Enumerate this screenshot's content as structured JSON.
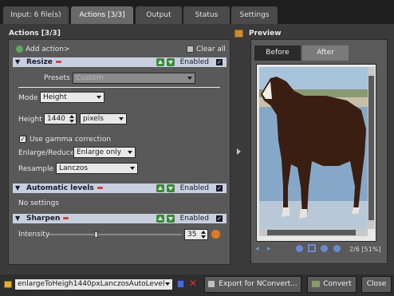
{
  "tabs": [
    {
      "label": "Input: 6 file(s)",
      "active": false
    },
    {
      "label": "Actions [3/3]",
      "active": true
    },
    {
      "label": "Output",
      "active": false
    },
    {
      "label": "Status",
      "active": false
    },
    {
      "label": "Settings",
      "active": false
    }
  ],
  "actions_title": "Actions [3/3]",
  "preview_title": "Preview",
  "toolbar": {
    "add_action": "Add action>",
    "clear_all": "Clear all"
  },
  "resize": {
    "name": "Resize",
    "enabled_label": "Enabled",
    "presets_label": "Presets",
    "presets_value": "Custom",
    "mode_label": "Mode",
    "mode_value": "Height",
    "height_label": "Height",
    "height_value": "1440",
    "unit_value": "pixels",
    "gamma_label": "Use gamma correction",
    "enlarge_label": "Enlarge/Reduce",
    "enlarge_value": "Enlarge only",
    "resample_label": "Resample",
    "resample_value": "Lanczos"
  },
  "auto_levels": {
    "name": "Automatic levels",
    "enabled_label": "Enabled",
    "no_settings": "No settings"
  },
  "sharpen": {
    "name": "Sharpen",
    "enabled_label": "Enabled",
    "intensity_label": "Intensity",
    "intensity_value": "35"
  },
  "preview": {
    "before_tab": "Before",
    "after_tab": "After",
    "status": "2/6 [51%]"
  },
  "bottom": {
    "preset_value": "enlargeToHeigh1440pxLanczosAutoLevel",
    "export_label": "Export for NConvert...",
    "convert_label": "Convert",
    "close_label": "Close"
  },
  "colors": {
    "header_bg": "#c8d0e0",
    "panel_bg": "#595959",
    "tab_active": "#6a6a6a"
  }
}
